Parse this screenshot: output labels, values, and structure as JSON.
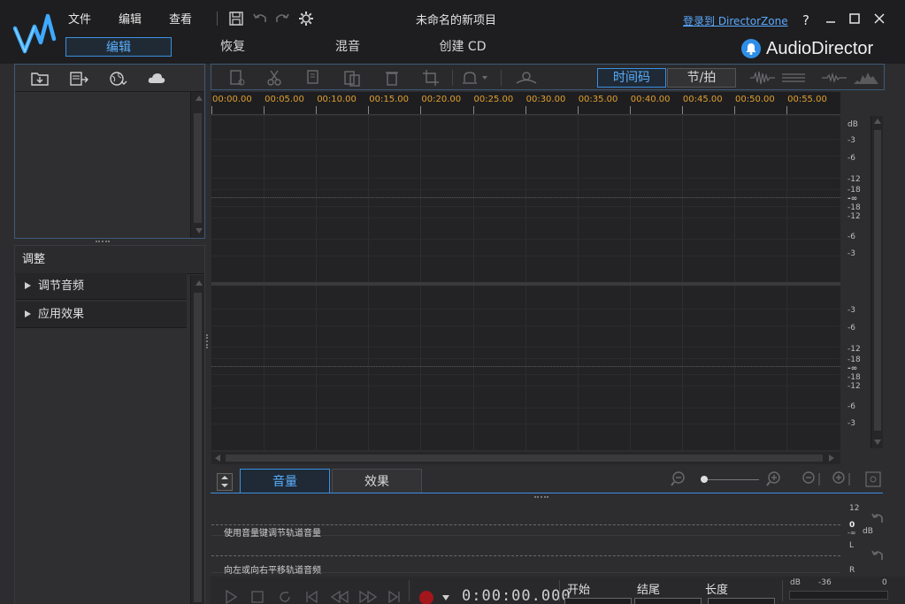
{
  "menu": {
    "file": "文件",
    "edit": "编辑",
    "view": "查看"
  },
  "window_title": "未命名的新项目",
  "login_link": "登录到 DirectorZone",
  "help": "?",
  "tabs": {
    "edit": "编辑",
    "restore": "恢复",
    "mix": "混音",
    "create_cd": "创建 CD"
  },
  "brand": "AudioDirector",
  "adjust": {
    "title": "调整",
    "adjust_audio": "调节音频",
    "apply_effect": "应用效果"
  },
  "view_mode": {
    "timecode": "时间码",
    "beat": "节/拍"
  },
  "ruler": [
    "00:00.00",
    "00:05.00",
    "00:10.00",
    "00:15.00",
    "00:20.00",
    "00:25.00",
    "00:30.00",
    "00:35.00",
    "00:40.00",
    "00:45.00",
    "00:50.00",
    "00:55.00"
  ],
  "db_scale": {
    "unit": "dB",
    "v1": "-3",
    "v2": "-6",
    "v3": "-12",
    "v4": "-18",
    "v5": "-∞"
  },
  "bottom_tabs": {
    "volume": "音量",
    "effects": "效果"
  },
  "lanes": {
    "volume_hint": "使用音量键调节轨道音量",
    "pan_hint": "向左或向右平移轨道音频",
    "vol_top": "12",
    "vol_zero": "0",
    "vol_inf": "-∞",
    "vol_unit": "dB",
    "pan_l": "L",
    "pan_r": "R"
  },
  "time_display": "0:00:00.000",
  "fields": {
    "start": "开始",
    "end": "结尾",
    "length": "长度"
  },
  "meter": {
    "unit": "dB",
    "m36": "-36",
    "zero": "0"
  }
}
